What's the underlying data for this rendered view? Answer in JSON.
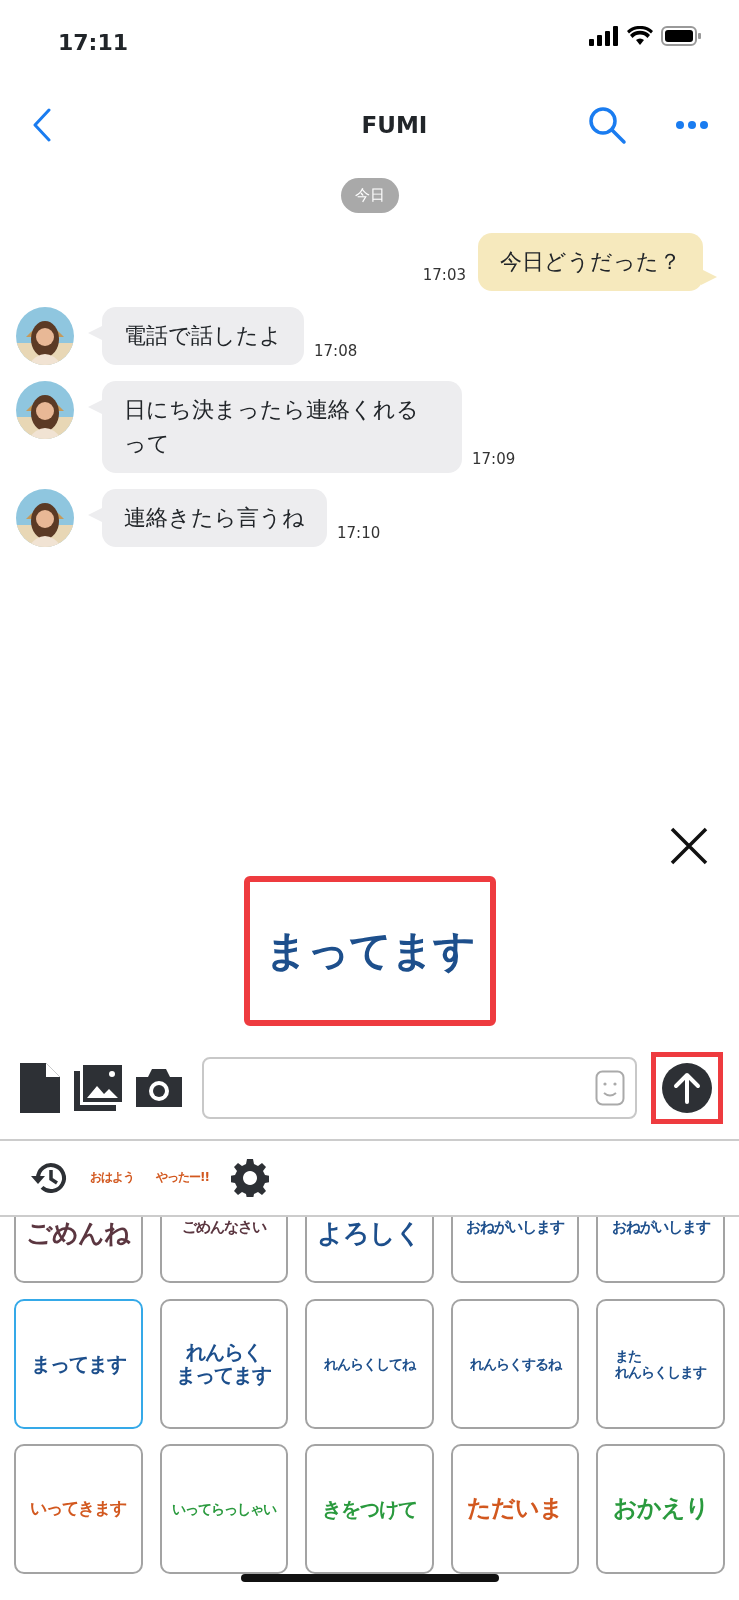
{
  "status_bar": {
    "time": "17:11"
  },
  "header": {
    "title": "FUMI"
  },
  "date_divider": "今日",
  "messages": [
    {
      "kind": "outgoing",
      "text": "今日どうだった？",
      "time": "17:03"
    },
    {
      "kind": "incoming",
      "text": "電話で話したよ",
      "time": "17:08"
    },
    {
      "kind": "incoming",
      "text": "日にち決まったら連絡くれるって",
      "time": "17:09"
    },
    {
      "kind": "incoming",
      "text": "連絡きたら言うね",
      "time": "17:10"
    }
  ],
  "sticker_preview": {
    "text": "まってます",
    "color": "#1d4f8c",
    "highlighted": true
  },
  "composer": {
    "send_highlighted": true
  },
  "sticker_tabs": [
    {
      "kind": "history"
    },
    {
      "kind": "sticker",
      "text": "おはよう",
      "color": "#d2581f"
    },
    {
      "kind": "sticker",
      "text": "やったー!!",
      "color": "#d2581f"
    },
    {
      "kind": "settings"
    }
  ],
  "stickers_partial": [
    {
      "text": "ごめんね",
      "color": "#5b3640"
    },
    {
      "text": "ごめんなさい",
      "color": "#5b3640"
    },
    {
      "text": "よろしく",
      "color": "#1d4f8c"
    },
    {
      "text": "おねがいします",
      "color": "#1d4f8c"
    },
    {
      "text": "おねがいします",
      "color": "#1d4f8c"
    }
  ],
  "stickers": [
    {
      "text": "まってます",
      "color": "#1d4f8c",
      "selected": true
    },
    {
      "lines": [
        "れんらく",
        "まってます"
      ],
      "color": "#1d4f8c",
      "selected": false
    },
    {
      "text": "れんらくしてね",
      "color": "#1d4f8c",
      "selected": false
    },
    {
      "text": "れんらくするね",
      "color": "#1d4f8c",
      "selected": false
    },
    {
      "lines": [
        "また",
        "れんらくします"
      ],
      "color": "#1d4f8c",
      "selected": false
    },
    {
      "text": "いってきます",
      "color": "#d2581f",
      "selected": false
    },
    {
      "text": "いってらっしゃい",
      "color": "#2a9a3e",
      "selected": false
    },
    {
      "text": "きをつけて",
      "color": "#2a9a3e",
      "selected": false
    },
    {
      "text": "ただいま",
      "color": "#d2581f",
      "selected": false
    },
    {
      "text": "おかえり",
      "color": "#2a9a3e",
      "selected": false
    }
  ]
}
